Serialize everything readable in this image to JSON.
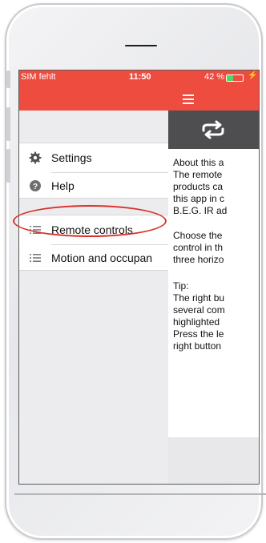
{
  "status_bar": {
    "carrier": "SIM fehlt",
    "time": "11:50",
    "battery_percent": "42 %",
    "battery_level": 0.42,
    "charging_icon": "bolt-icon"
  },
  "app_bar": {
    "menu_icon": "hamburger-icon"
  },
  "sidebar": {
    "group1": [
      {
        "label": "Settings",
        "icon": "gear-icon"
      },
      {
        "label": "Help",
        "icon": "help-icon"
      }
    ],
    "group2": [
      {
        "label": "Remote controls",
        "icon": "list-icon"
      },
      {
        "label": "Motion and occupan",
        "icon": "list-icon"
      }
    ]
  },
  "content": {
    "header_icon": "repeat-icon",
    "paragraphs": [
      [
        "About this a",
        "The remote",
        "products ca",
        "this app in c",
        "B.E.G. IR ad"
      ],
      [
        "Choose the",
        "control in th",
        "three horizo"
      ],
      [
        "Tip:",
        "The right bu",
        "several com",
        "highlighted",
        "Press the le",
        "right button"
      ]
    ]
  },
  "colors": {
    "accent": "#ef4c40",
    "header_dark": "#4e4e50",
    "annotation": "#d83128"
  }
}
